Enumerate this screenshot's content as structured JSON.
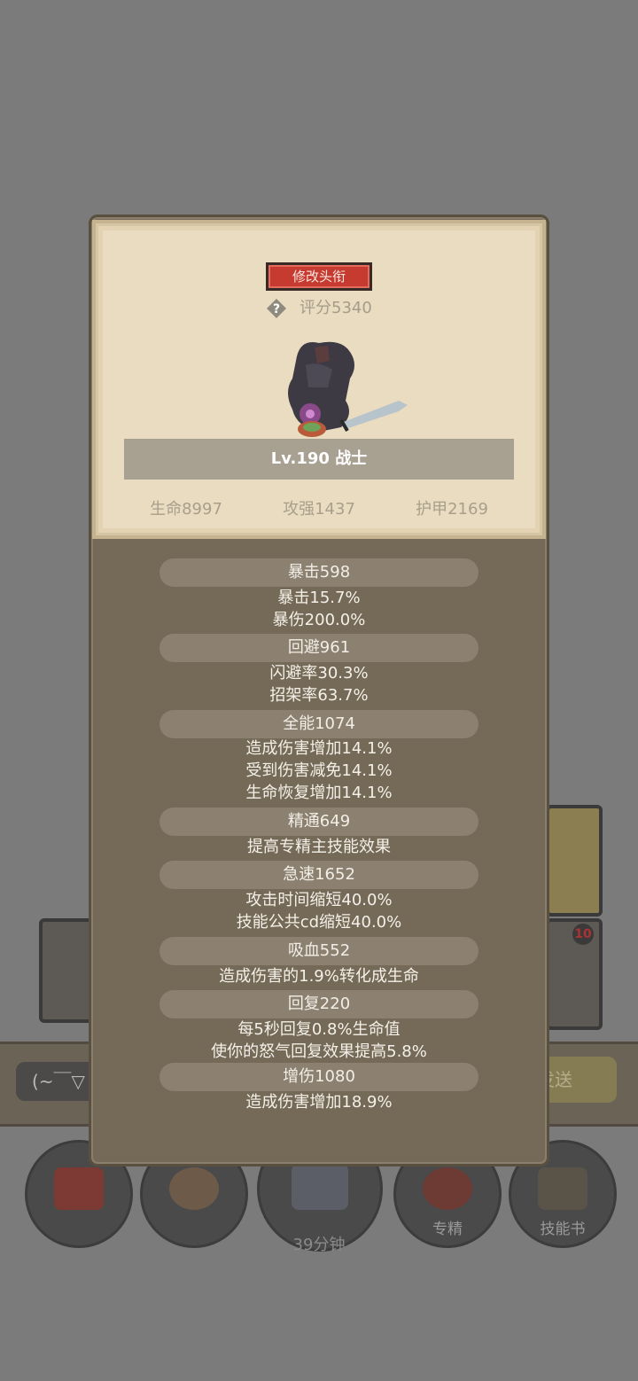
{
  "panel": {
    "rename_label": "修改头衔",
    "score_label": "评分5340",
    "level_label": "Lv.190 战士",
    "top_stats": [
      "生命8997",
      "攻强1437",
      "护甲2169"
    ]
  },
  "stats": [
    {
      "header": "暴击598",
      "lines": [
        "暴击15.7%",
        "暴伤200.0%"
      ]
    },
    {
      "header": "回避961",
      "lines": [
        "闪避率30.3%",
        "招架率63.7%"
      ]
    },
    {
      "header": "全能1074",
      "lines": [
        "造成伤害增加14.1%",
        "受到伤害减免14.1%",
        "生命恢复增加14.1%"
      ]
    },
    {
      "header": "精通649",
      "lines": [
        "提高专精主技能效果"
      ]
    },
    {
      "header": "急速1652",
      "lines": [
        "攻击时间缩短40.0%",
        "技能公共cd缩短40.0%"
      ]
    },
    {
      "header": "吸血552",
      "lines": [
        "造成伤害的1.9%转化成生命"
      ]
    },
    {
      "header": "回复220",
      "lines": [
        "每5秒回复0.8%生命值",
        "使你的怒气回复效果提高5.8%"
      ]
    },
    {
      "header": "增伤1080",
      "lines": [
        "造成伤害增加18.9%"
      ]
    }
  ],
  "background": {
    "chat_placeholder": "(~￣▽",
    "send_label": "发送",
    "timer_label": "39分钟",
    "spec_label": "专精",
    "skillbook_label": "技能书",
    "badge_count": "10"
  },
  "colors": {
    "rename_button": "#c73a2f",
    "panel_bg": "#756a58",
    "parchment": "#e9dcc0"
  }
}
